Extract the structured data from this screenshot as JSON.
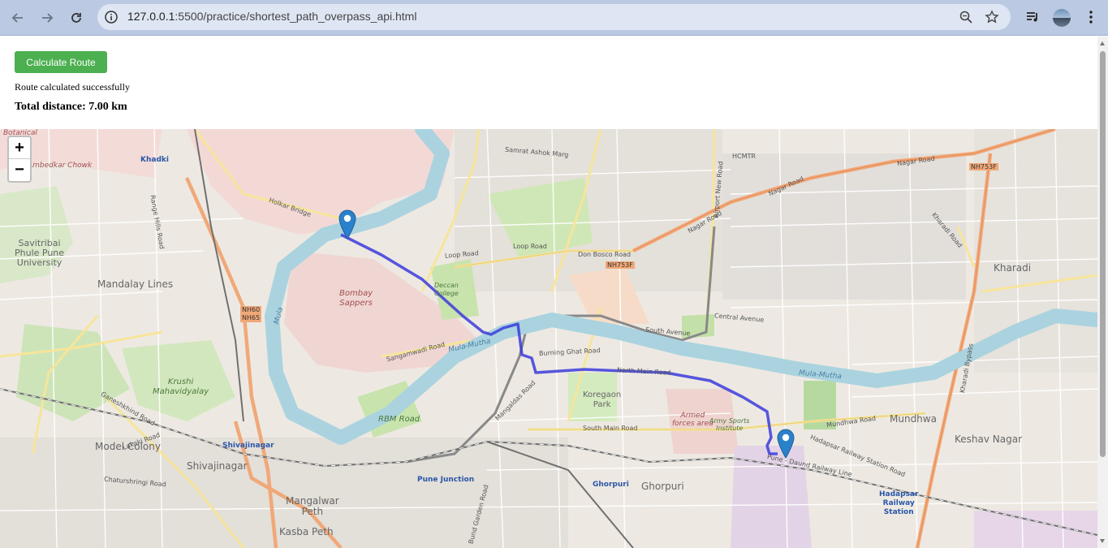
{
  "browser": {
    "url_host": "127.0.0.1",
    "url_rest": ":5500/practice/shortest_path_overpass_api.html"
  },
  "page": {
    "button_label": "Calculate Route",
    "status_text": "Route calculated successfully",
    "distance_text": "Total distance: 7.00 km"
  },
  "map": {
    "zoom_in": "+",
    "zoom_out": "−",
    "labels": {
      "khadki": "Khadki",
      "ambedkar_chowk": "Ambedkar Chowk",
      "botanical": "Botanical",
      "savitribai": "Savitribai\nPhule Pune\nUniversity",
      "mandalay": "Mandalay Lines",
      "bombay_sappers": "Bombay\nSappers",
      "deccan_college": "Deccan\nCollege",
      "krushi": "Krushi\nMahavidyalay",
      "rbm_road": "RBM Road",
      "model_colony": "Model Colony",
      "shivajinagar": "Shivajinagar",
      "shivajinagar_stn": "Shivajinagar",
      "pune_junction": "Pune Junction",
      "mangalwar": "Mangalwar\nPeth",
      "kasba": "Kasba Peth",
      "koregaon": "Koregaon\nPark",
      "armed_forces": "Armed\nforces area",
      "army_sports": "Army Sports\nInstitute",
      "ghorpuri": "Ghorpuri",
      "ghorpuri_stn": "Ghorpuri",
      "mundhwa": "Mundhwa",
      "keshav": "Keshav Nagar",
      "hadapsar_stn": "Hadapsar\nRailway\nStation",
      "kharadi": "Kharadi",
      "hcmtr": "HCMTR",
      "nh753f_top": "NH753F",
      "nh753f_mid": "NH753F",
      "nh60": "NH60\nNH65",
      "mula": "Mula",
      "mula_mutha_1": "Mula-Mutha",
      "mula_mutha_2": "Mula-Mutha",
      "samrat": "Samrat Ashok Marg",
      "loop_road_1": "Loop Road",
      "loop_road_2": "Loop Road",
      "don_bosco": "Don Bosco Road",
      "nagar_road_1": "Nagar Road",
      "nagar_road_2": "Nagar Road",
      "nagar_road_3": "Nagar Road",
      "central_avenue": "Central Avenue",
      "south_avenue": "South Avenue",
      "burning_ghat": "Burning Ghat Road",
      "north_main": "North Main Road",
      "south_main": "South Main Road",
      "mundhwa_road": "Mundhwa Road",
      "hadapsar_rly_rd": "Hadapsar Railway Station Road",
      "pune_daund": "Pune - Daund Railway Line",
      "sangamwadi": "Sangamwadi Road",
      "holkar": "Holkar Bridge",
      "range_hills": "Range Hills Road",
      "mangaldas": "Mangaldas Road",
      "bund_garden": "Bund Garden Road",
      "lakaki": "Lakaki Road",
      "chaturshringi": "Chaturshringi Road",
      "ganeshkhind": "Ganeshkhind Road",
      "kharadi_road": "Kharadi Road",
      "kharadi_bypass": "Kharadi Bypass",
      "airport_road": "Airport New Road"
    }
  },
  "colors": {
    "route": "#3b3bdc",
    "river": "#aad3df",
    "button": "#4caf50",
    "marker": "#2a81cb"
  }
}
